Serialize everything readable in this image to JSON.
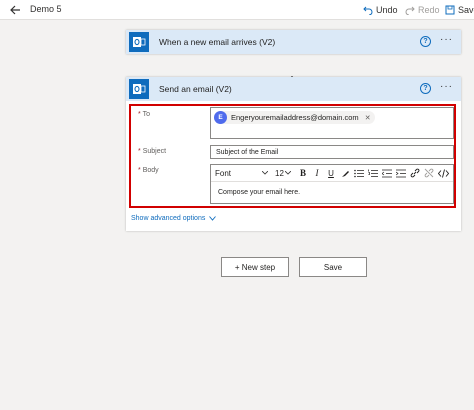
{
  "topbar": {
    "flow_name": "Demo 5",
    "undo_label": "Undo",
    "redo_label": "Redo",
    "save_label": "Save"
  },
  "trigger_card": {
    "title": "When a new email arrives (V2)"
  },
  "action_card": {
    "title": "Send an email (V2)",
    "to_label": "To",
    "to_chip_initial": "E",
    "to_chip_text": "Engeryouremailaddress@domain.com",
    "subject_label": "Subject",
    "subject_value": "Subject of the Email",
    "body_label": "Body",
    "font_value": "Font",
    "font_size_value": "12",
    "body_value": "Compose your email here.",
    "advanced_link": "Show advanced options",
    "required_marker": "*"
  },
  "footer": {
    "new_step_label": "+ New step",
    "save_label": "Save"
  },
  "colors": {
    "header_bg": "#dbe9f7",
    "outlook_blue": "#0f6cbd",
    "highlight_red": "#d10000",
    "chip_avatar": "#4f6bed"
  }
}
